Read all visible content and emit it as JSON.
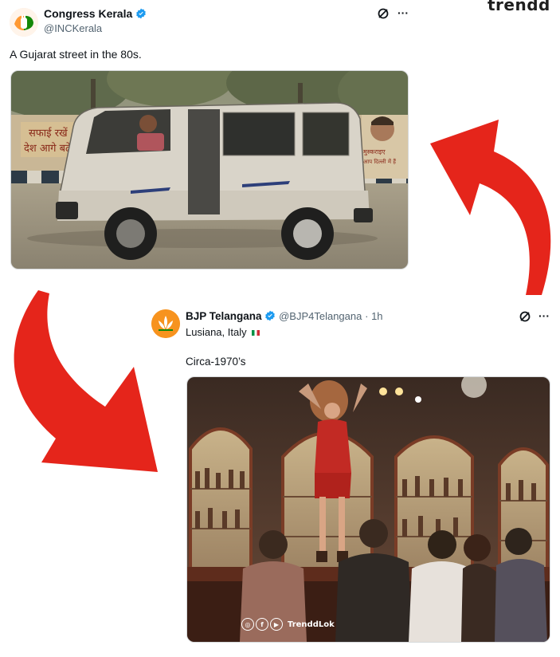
{
  "watermark": "trendd",
  "tweet1": {
    "name": "Congress Kerala",
    "handle": "@INCKerala",
    "text": "A Gujarat street in the 80s.",
    "more": "···",
    "wall_text_1": "सफाई रखें",
    "wall_text_2": "देश आगे बढ़े",
    "poster_text_1": "मुस्कराइए",
    "poster_text_2": "आप दिल्ली में हैं"
  },
  "tweet2": {
    "name": "BJP Telangana",
    "handle": "@BJP4Telangana",
    "time": "· 1h",
    "location": "Lusiana, Italy",
    "text": "Circa-1970’s",
    "more": "···",
    "watermark_label": "TrenddLok"
  },
  "colors": {
    "verified": "#1d9bf0",
    "arrow": "#e5251b",
    "inc_avatar": "#f4c7a1",
    "bjp_avatar": "#f7931e"
  }
}
